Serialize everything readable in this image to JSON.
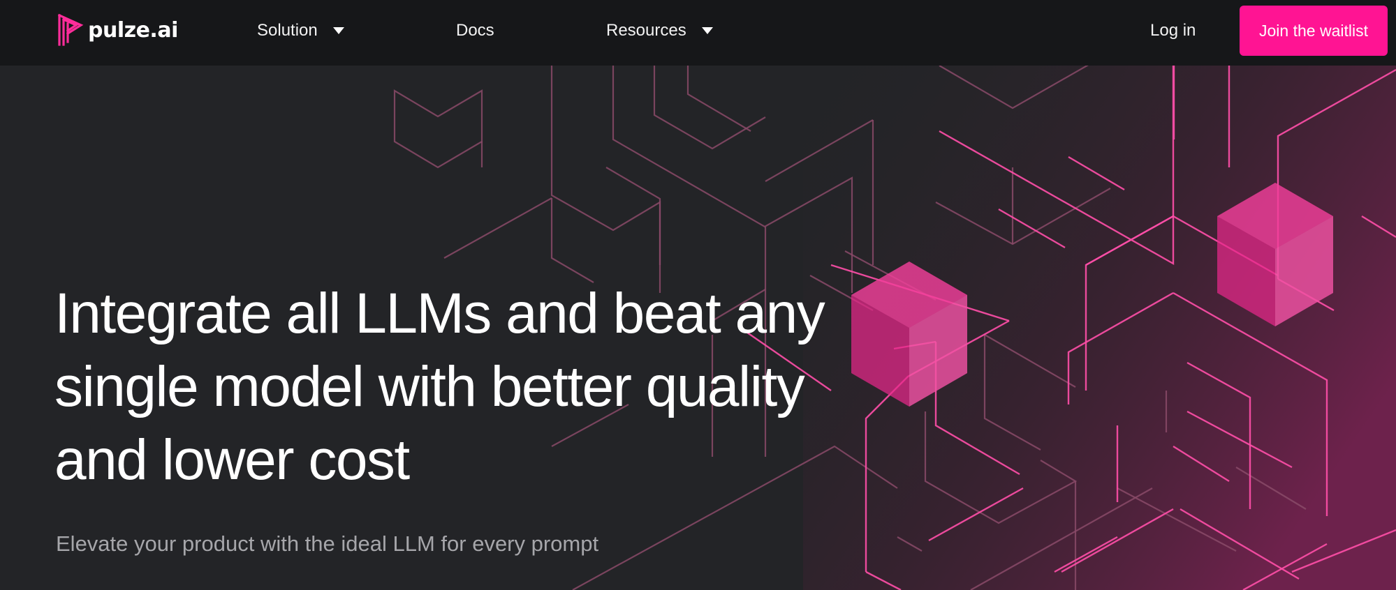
{
  "brand": {
    "name": "pulze.ai",
    "accent_color": "#ff1493",
    "logo_icon": "pulze-logo-icon"
  },
  "nav": {
    "items": [
      {
        "label": "Solution",
        "has_dropdown": true
      },
      {
        "label": "Docs",
        "has_dropdown": false
      },
      {
        "label": "Resources",
        "has_dropdown": true
      }
    ],
    "login_label": "Log in",
    "cta_label": "Join the waitlist",
    "dropdown_icon": "caret-down-icon"
  },
  "hero": {
    "title_lines": [
      "Integrate all LLMs and beat any",
      "single model with better quality",
      "and lower cost"
    ],
    "subtitle": "Elevate your product with the ideal LLM for every prompt",
    "background_graphic": "hexagon-line-network",
    "colors": {
      "background": "#232427",
      "navbar": "#161719",
      "line_pink": "#ff4fa8",
      "cube_pink": "#e8288a"
    }
  }
}
